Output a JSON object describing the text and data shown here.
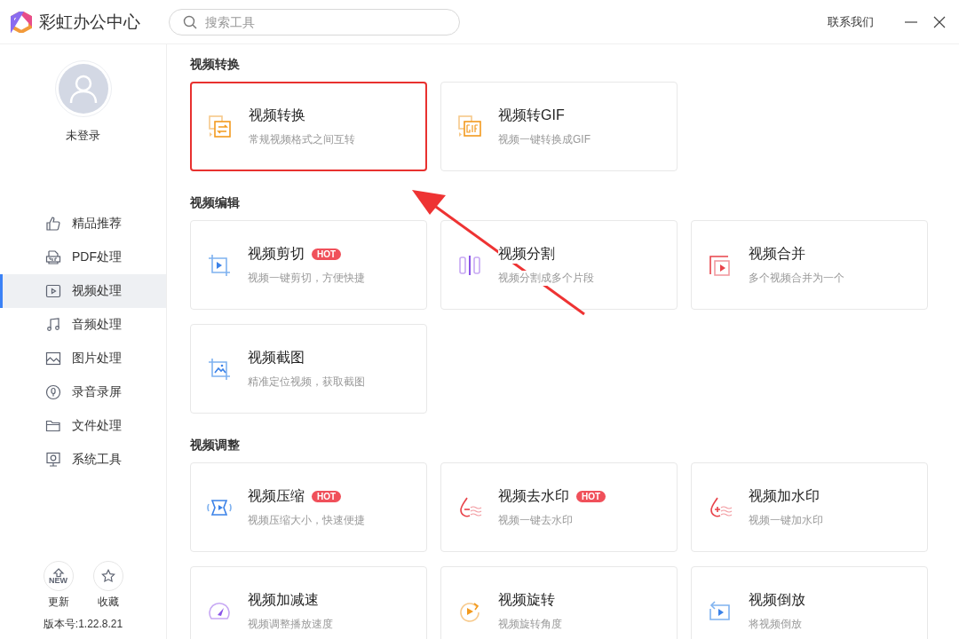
{
  "app": {
    "title": "彩虹办公中心"
  },
  "search": {
    "placeholder": "搜索工具"
  },
  "header_actions": {
    "contact": "联系我们"
  },
  "user": {
    "name": "未登录"
  },
  "sidebar": {
    "items": [
      {
        "label": "精品推荐",
        "kind": "thumb",
        "selected": false
      },
      {
        "label": "PDF处理",
        "kind": "pdf",
        "selected": false
      },
      {
        "label": "视频处理",
        "kind": "video",
        "selected": true
      },
      {
        "label": "音频处理",
        "kind": "music",
        "selected": false
      },
      {
        "label": "图片处理",
        "kind": "image",
        "selected": false
      },
      {
        "label": "录音录屏",
        "kind": "record",
        "selected": false
      },
      {
        "label": "文件处理",
        "kind": "folder",
        "selected": false
      },
      {
        "label": "系统工具",
        "kind": "system",
        "selected": false
      }
    ]
  },
  "footer": {
    "buttons": [
      {
        "label": "更新",
        "kind": "update",
        "icon_text": "NEW"
      },
      {
        "label": "收藏",
        "kind": "star"
      }
    ],
    "version": "版本号:1.22.8.21"
  },
  "sections": [
    {
      "title": "视频转换",
      "tools": [
        {
          "name": "视频转换",
          "desc": "常规视频格式之间互转",
          "kind": "convert",
          "hot": false,
          "highlighted": true
        },
        {
          "name": "视频转GIF",
          "desc": "视频一键转换成GIF",
          "kind": "gif",
          "hot": false,
          "highlighted": false
        }
      ]
    },
    {
      "title": "视频编辑",
      "tools": [
        {
          "name": "视频剪切",
          "desc": "视频一键剪切，方便快捷",
          "kind": "cut",
          "hot": true,
          "badge": "HOT",
          "highlighted": false
        },
        {
          "name": "视频分割",
          "desc": "视频分割成多个片段",
          "kind": "split",
          "hot": false,
          "highlighted": false
        },
        {
          "name": "视频合并",
          "desc": "多个视频合并为一个",
          "kind": "merge",
          "hot": false,
          "highlighted": false
        },
        {
          "name": "视频截图",
          "desc": "精准定位视频，获取截图",
          "kind": "shot",
          "hot": false,
          "highlighted": false
        }
      ]
    },
    {
      "title": "视频调整",
      "tools": [
        {
          "name": "视频压缩",
          "desc": "视频压缩大小，快速便捷",
          "kind": "compress",
          "hot": true,
          "badge": "HOT",
          "highlighted": false
        },
        {
          "name": "视频去水印",
          "desc": "视频一键去水印",
          "kind": "unmark",
          "hot": true,
          "badge": "HOT",
          "highlighted": false
        },
        {
          "name": "视频加水印",
          "desc": "视频一键加水印",
          "kind": "mark",
          "hot": false,
          "highlighted": false
        },
        {
          "name": "视频加减速",
          "desc": "视频调整播放速度",
          "kind": "speed",
          "hot": false,
          "highlighted": false
        },
        {
          "name": "视频旋转",
          "desc": "视频旋转角度",
          "kind": "rotate",
          "hot": false,
          "highlighted": false
        },
        {
          "name": "视频倒放",
          "desc": "将视频倒放",
          "kind": "reverse",
          "hot": false,
          "highlighted": false
        }
      ]
    }
  ],
  "annotation": {
    "arrow": true
  }
}
